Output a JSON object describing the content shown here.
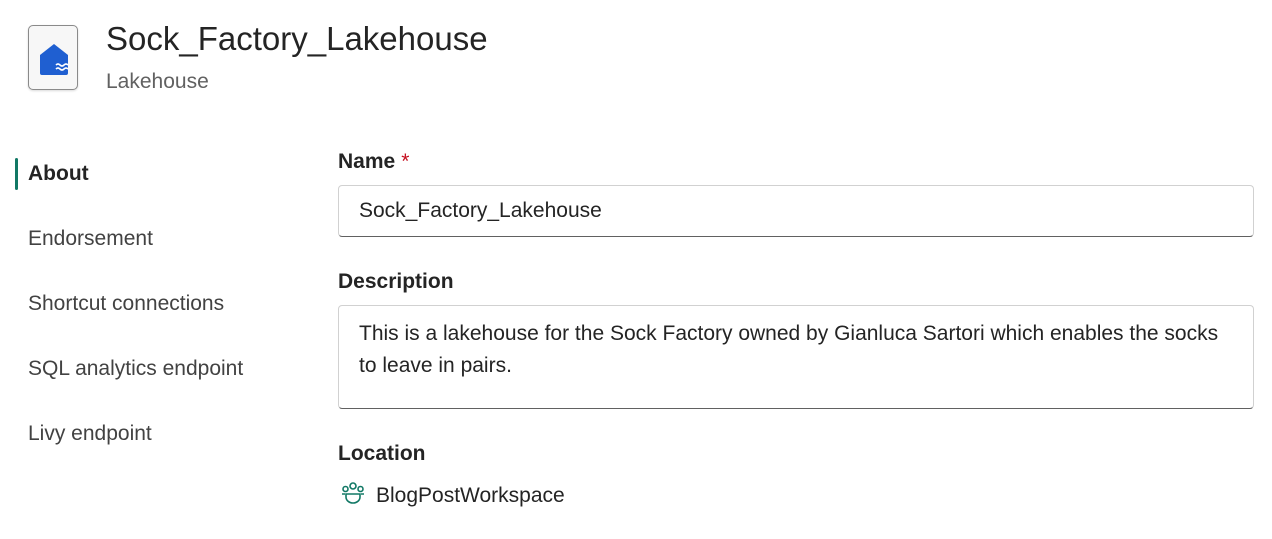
{
  "header": {
    "title": "Sock_Factory_Lakehouse",
    "subtitle": "Lakehouse",
    "icon": "lakehouse-icon"
  },
  "sidebar": {
    "items": [
      {
        "label": "About",
        "active": true
      },
      {
        "label": "Endorsement",
        "active": false
      },
      {
        "label": "Shortcut connections",
        "active": false
      },
      {
        "label": "SQL analytics endpoint",
        "active": false
      },
      {
        "label": "Livy endpoint",
        "active": false
      }
    ],
    "accent_color": "#117865"
  },
  "form": {
    "name_label": "Name",
    "required_marker": "*",
    "name_value": "Sock_Factory_Lakehouse",
    "description_label": "Description",
    "description_value": "This is a lakehouse for the Sock Factory owned by Gianluca Sartori which enables the socks to leave in pairs.",
    "location_label": "Location",
    "location_value": "BlogPostWorkspace",
    "location_icon": "workspace-icon"
  }
}
